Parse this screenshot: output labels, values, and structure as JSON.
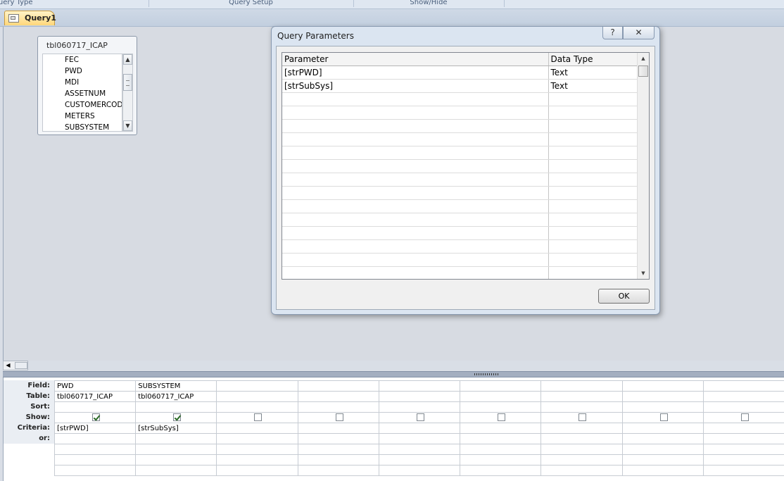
{
  "ribbon": {
    "groups": [
      {
        "label": "Query Type"
      },
      {
        "label": "Query Setup"
      },
      {
        "label": "Show/Hide"
      }
    ]
  },
  "document_tab": {
    "label": "Query1",
    "icon": "query-icon"
  },
  "table": {
    "name": "tbl060717_ICAP",
    "fields": [
      "FEC",
      "PWD",
      "MDI",
      "ASSETNUM",
      "CUSTOMERCOD",
      "METERS",
      "SUBSYSTEM"
    ]
  },
  "design_grid": {
    "row_labels": [
      "Field:",
      "Table:",
      "Sort:",
      "Show:",
      "Criteria:",
      "or:"
    ],
    "columns": [
      {
        "field": "PWD",
        "table": "tbl060717_ICAP",
        "sort": "",
        "show": true,
        "criteria": "[strPWD]",
        "or": ""
      },
      {
        "field": "SUBSYSTEM",
        "table": "tbl060717_ICAP",
        "sort": "",
        "show": true,
        "criteria": "[strSubSys]",
        "or": ""
      },
      {
        "field": "",
        "table": "",
        "sort": "",
        "show": false,
        "criteria": "",
        "or": ""
      },
      {
        "field": "",
        "table": "",
        "sort": "",
        "show": false,
        "criteria": "",
        "or": ""
      },
      {
        "field": "",
        "table": "",
        "sort": "",
        "show": false,
        "criteria": "",
        "or": ""
      },
      {
        "field": "",
        "table": "",
        "sort": "",
        "show": false,
        "criteria": "",
        "or": ""
      },
      {
        "field": "",
        "table": "",
        "sort": "",
        "show": false,
        "criteria": "",
        "or": ""
      },
      {
        "field": "",
        "table": "",
        "sort": "",
        "show": false,
        "criteria": "",
        "or": ""
      },
      {
        "field": "",
        "table": "",
        "sort": "",
        "show": false,
        "criteria": "",
        "or": ""
      }
    ]
  },
  "dialog": {
    "title": "Query Parameters",
    "help_label": "?",
    "close_label": "✕",
    "headers": {
      "parameter": "Parameter",
      "data_type": "Data Type"
    },
    "rows": [
      {
        "parameter": "[strPWD]",
        "data_type": "Text"
      },
      {
        "parameter": "[strSubSys]",
        "data_type": "Text"
      }
    ],
    "empty_rows": 14,
    "ok_label": "OK"
  }
}
